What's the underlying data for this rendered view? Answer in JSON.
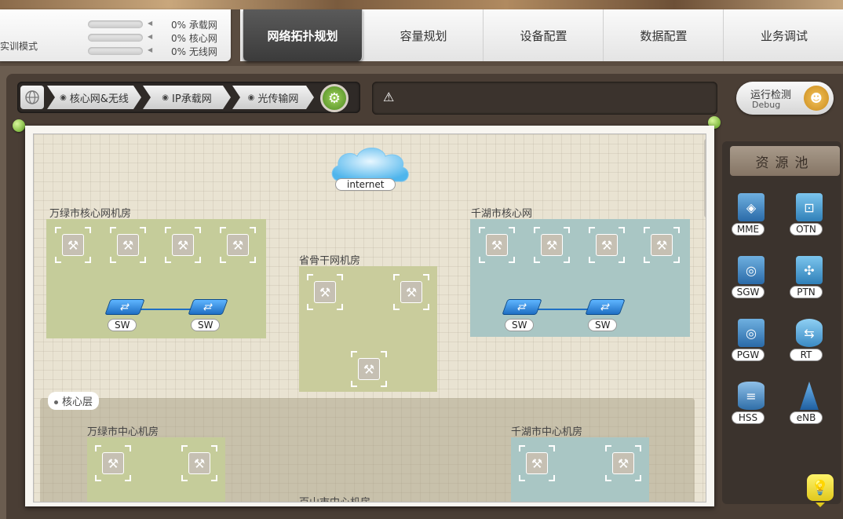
{
  "header": {
    "mode_label": "实训模式",
    "progress": [
      {
        "text": "0% 承载网",
        "fraction": 0
      },
      {
        "text": "0% 核心网",
        "fraction": 0
      },
      {
        "text": "0% 无线网",
        "fraction": 0
      }
    ]
  },
  "tabs": [
    {
      "label": "网络拓扑规划",
      "active": true
    },
    {
      "label": "容量规划",
      "active": false
    },
    {
      "label": "设备配置",
      "active": false
    },
    {
      "label": "数据配置",
      "active": false
    },
    {
      "label": "业务调试",
      "active": false
    }
  ],
  "toolbar": {
    "breadcrumbs": [
      "核心网&无线",
      "IP承载网",
      "光传输网"
    ],
    "debug_title": "运行检测",
    "debug_sub": "Debug"
  },
  "canvas": {
    "internet_label": "internet",
    "zones": {
      "wanlv_core": "万绿市核心网机房",
      "qianhu_core": "千湖市核心网",
      "province_backbone": "省骨干网机房",
      "wanlv_center": "万绿市中心机房",
      "qianhu_center": "千湖市中心机房",
      "baishan_center": "百山市中心机房"
    },
    "core_layer_label": "核心层",
    "switch_label": "SW"
  },
  "resource_pool": {
    "title": "资源池",
    "items": [
      "MME",
      "OTN",
      "SGW",
      "PTN",
      "PGW",
      "RT",
      "HSS",
      "eNB"
    ]
  },
  "colors": {
    "active_tab": "#3b3b3b",
    "green_zone": "#c5cc9a",
    "teal_zone": "#a9c6c4",
    "switch_blue": "#1f6fc4"
  }
}
